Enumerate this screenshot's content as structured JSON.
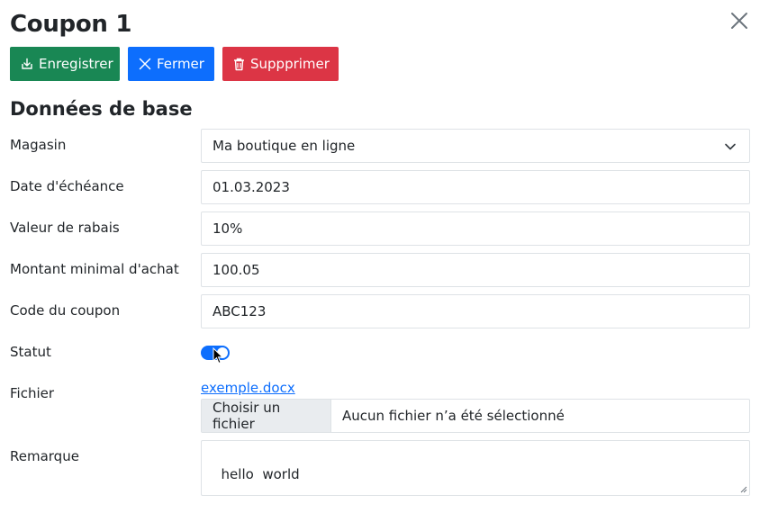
{
  "header": {
    "title": "Coupon 1"
  },
  "toolbar": {
    "save_label": "Enregistrer",
    "close_label": "Fermer",
    "delete_label": "Suppprimer"
  },
  "section": {
    "title": "Données de base"
  },
  "form": {
    "shop": {
      "label": "Magasin",
      "value": "Ma boutique en ligne"
    },
    "due_date": {
      "label": "Date d'échéance",
      "value": "01.03.2023"
    },
    "discount": {
      "label": "Valeur de rabais",
      "value": "10%"
    },
    "min_amount": {
      "label": "Montant minimal d'achat",
      "value": "100.05"
    },
    "code": {
      "label": "Code du coupon",
      "value": "ABC123"
    },
    "status": {
      "label": "Statut",
      "checked": true
    },
    "file": {
      "label": "Fichier",
      "link": "exemple.docx",
      "button": "Choisir un fichier",
      "status": "Aucun fichier n’a été sélectionné"
    },
    "remark": {
      "label": "Remarque",
      "value": "hello  world"
    }
  },
  "colors": {
    "save": "#198754",
    "close": "#0d6efd",
    "delete": "#dc3545",
    "switch_on": "#0d6efd",
    "link": "#0d6efd"
  },
  "icons": {
    "close": "close-icon",
    "save": "download-icon",
    "fermer": "x-icon",
    "delete": "trash-icon",
    "select": "chevron-down-icon"
  }
}
